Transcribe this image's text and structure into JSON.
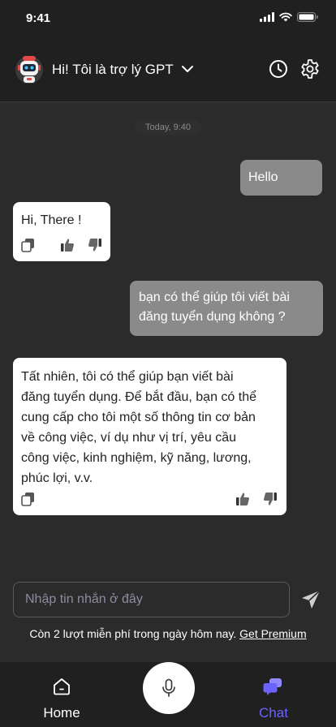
{
  "status_bar": {
    "time": "9:41"
  },
  "header": {
    "title": "Hi! Tôi là trợ lý GPT",
    "icons": [
      "robot-avatar",
      "chevron-down-icon",
      "history-clock-icon",
      "gear-icon"
    ]
  },
  "chat": {
    "timestamp": "Today, 9:40",
    "messages": [
      {
        "role": "user",
        "text": "Hello"
      },
      {
        "role": "bot",
        "text": "Hi, There !"
      },
      {
        "role": "user",
        "lines": [
          "bạn có thể giúp tôi viết bài",
          "đăng tuyển dụng không ?"
        ]
      },
      {
        "role": "bot",
        "lines": [
          "Tất nhiên, tôi có thể giúp bạn viết bài",
          "đăng tuyển dụng. Để bắt đầu, bạn có thể",
          "cung cấp cho tôi một số thông tin cơ bản",
          "về công việc, ví dụ như vị trí, yêu cầu",
          "công việc, kinh nghiệm, kỹ năng, lương,",
          "phúc lợi, v.v."
        ]
      }
    ]
  },
  "composer": {
    "placeholder": "Nhập tin nhắn ở đây",
    "note": "Còn 2 lượt miễn phí trong ngày hôm nay.",
    "premium_link": "Get Premium"
  },
  "nav": {
    "home_label": "Home",
    "chat_label": "Chat",
    "active": "Chat",
    "active_color": "#6c63ff"
  },
  "colors": {
    "background": "#2b2b2b",
    "bar": "#202020",
    "user_bubble": "#8a8a8a",
    "bot_bubble": "#ffffff",
    "accent": "#6c63ff"
  }
}
